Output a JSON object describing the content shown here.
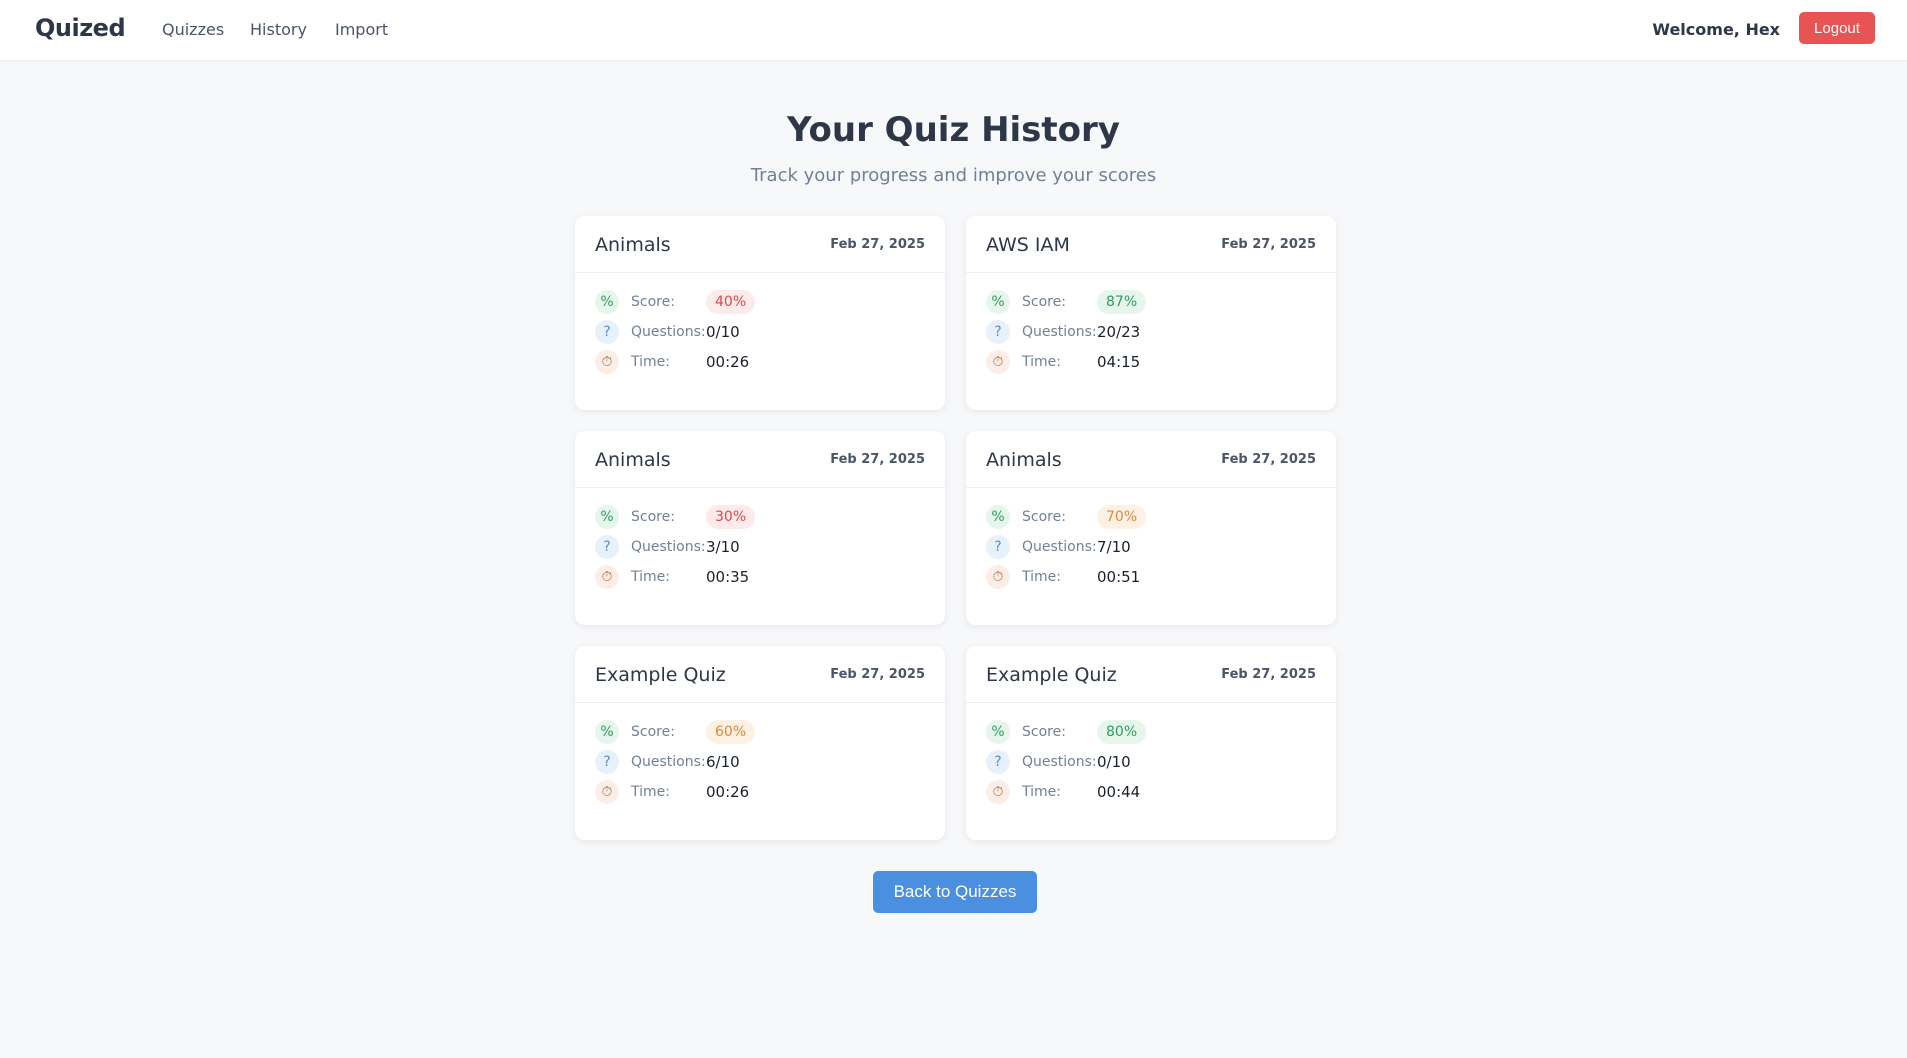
{
  "nav": {
    "brand": "Quized",
    "links": [
      "Quizzes",
      "History",
      "Import"
    ],
    "welcome": "Welcome, Hex",
    "logout_label": "Logout"
  },
  "page": {
    "title": "Your Quiz History",
    "subtitle": "Track your progress and improve your scores",
    "back_label": "Back to Quizzes"
  },
  "labels": {
    "score": "Score:",
    "questions": "Questions:",
    "time": "Time:"
  },
  "icons": {
    "score": "percent-icon",
    "questions": "question-icon",
    "time": "stopwatch-icon"
  },
  "colors": {
    "red": "#e04848",
    "orange": "#e08a3c",
    "green": "#2f9e5a",
    "logout": "#e85454",
    "primary": "#4a8fe0"
  },
  "history": [
    {
      "title": "Animals",
      "date": "Feb 27, 2025",
      "score": "40%",
      "score_level": "red",
      "questions": "0/10",
      "time": "00:26"
    },
    {
      "title": "AWS IAM",
      "date": "Feb 27, 2025",
      "score": "87%",
      "score_level": "green",
      "questions": "20/23",
      "time": "04:15"
    },
    {
      "title": "Animals",
      "date": "Feb 27, 2025",
      "score": "30%",
      "score_level": "red",
      "questions": "3/10",
      "time": "00:35"
    },
    {
      "title": "Animals",
      "date": "Feb 27, 2025",
      "score": "70%",
      "score_level": "orange",
      "questions": "7/10",
      "time": "00:51"
    },
    {
      "title": "Example Quiz",
      "date": "Feb 27, 2025",
      "score": "60%",
      "score_level": "orange",
      "questions": "6/10",
      "time": "00:26"
    },
    {
      "title": "Example Quiz",
      "date": "Feb 27, 2025",
      "score": "80%",
      "score_level": "green",
      "questions": "0/10",
      "time": "00:44"
    }
  ]
}
